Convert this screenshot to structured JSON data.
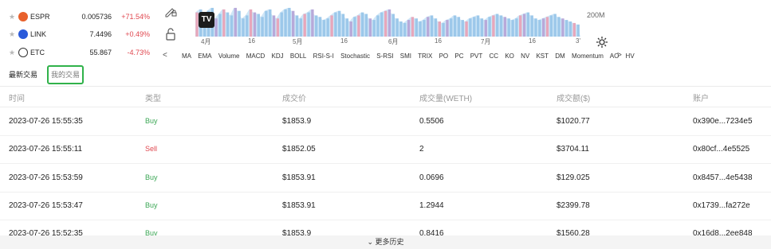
{
  "watchlist": [
    {
      "symbol": "ESPR",
      "price": "0.005736",
      "change": "+71.54%",
      "icon_color": "#e8612c"
    },
    {
      "symbol": "LINK",
      "price": "7.4496",
      "change": "+0.49%",
      "icon_color": "#2a5ada"
    },
    {
      "symbol": "ETC",
      "price": "55.867",
      "change": "-4.73%",
      "icon_color": "#333333"
    }
  ],
  "chart": {
    "volume_label": "200M",
    "x_ticks": [
      "4月",
      "16",
      "5月",
      "16",
      "6月",
      "16",
      "7月",
      "16",
      "3'"
    ],
    "logo_text": "TV",
    "bar_heights": [
      0.8,
      0.9,
      0.7,
      0.85,
      0.95,
      0.6,
      0.75,
      0.9,
      0.8,
      0.7,
      0.95,
      0.85,
      0.6,
      0.7,
      0.9,
      0.8,
      0.75,
      0.65,
      0.85,
      0.9,
      0.7,
      0.6,
      0.8,
      0.9,
      0.95,
      0.85,
      0.7,
      0.6,
      0.75,
      0.8,
      0.9,
      0.7,
      0.65,
      0.55,
      0.6,
      0.7,
      0.8,
      0.85,
      0.75,
      0.6,
      0.5,
      0.65,
      0.7,
      0.8,
      0.75,
      0.6,
      0.55,
      0.7,
      0.8,
      0.85,
      0.9,
      0.75,
      0.6,
      0.5,
      0.45,
      0.55,
      0.65,
      0.6,
      0.5,
      0.55,
      0.65,
      0.7,
      0.6,
      0.5,
      0.45,
      0.55,
      0.6,
      0.7,
      0.65,
      0.55,
      0.5,
      0.6,
      0.65,
      0.7,
      0.6,
      0.55,
      0.65,
      0.7,
      0.75,
      0.7,
      0.65,
      0.6,
      0.55,
      0.6,
      0.7,
      0.75,
      0.8,
      0.7,
      0.6,
      0.55,
      0.6,
      0.65,
      0.7,
      0.75,
      0.65,
      0.6,
      0.55,
      0.5,
      0.45,
      0.4
    ],
    "bar_colors": [
      "#9cc8ea",
      "#e7a7bb",
      "#b8a9d9"
    ]
  },
  "indicators": {
    "prev": "<",
    "next": ">",
    "items": [
      "MA",
      "EMA",
      "Volume",
      "MACD",
      "KDJ",
      "BOLL",
      "RSI-S-I",
      "Stochastic",
      "S-RSI",
      "SMI",
      "TRIX",
      "PO",
      "PC",
      "PVT",
      "CC",
      "KO",
      "NV",
      "KST",
      "DM",
      "Momentum",
      "AO",
      "HV"
    ]
  },
  "tabs": {
    "latest": "最新交易",
    "mine": "我的交易"
  },
  "table": {
    "headers": [
      "时间",
      "类型",
      "成交价",
      "成交量(WETH)",
      "成交额($)",
      "账户"
    ],
    "rows": [
      {
        "time": "2023-07-26 15:55:35",
        "type": "Buy",
        "price": "$1853.9",
        "qty": "0.5506",
        "amount": "$1020.77",
        "account": "0x390e...7234e5"
      },
      {
        "time": "2023-07-26 15:55:11",
        "type": "Sell",
        "price": "$1852.05",
        "qty": "2",
        "amount": "$3704.11",
        "account": "0x80cf...4e5525"
      },
      {
        "time": "2023-07-26 15:53:59",
        "type": "Buy",
        "price": "$1853.91",
        "qty": "0.0696",
        "amount": "$129.025",
        "account": "0x8457...4e5438"
      },
      {
        "time": "2023-07-26 15:53:47",
        "type": "Buy",
        "price": "$1853.91",
        "qty": "1.2944",
        "amount": "$2399.78",
        "account": "0x1739...fa272e"
      },
      {
        "time": "2023-07-26 15:52:35",
        "type": "Buy",
        "price": "$1853.9",
        "qty": "0.8416",
        "amount": "$1560.28",
        "account": "0x16d8...2ee848"
      }
    ]
  },
  "more_history": "更多历史",
  "colors": {
    "buy": "#3aa654",
    "sell": "#e0474f",
    "tab_highlight": "#30b24a"
  }
}
